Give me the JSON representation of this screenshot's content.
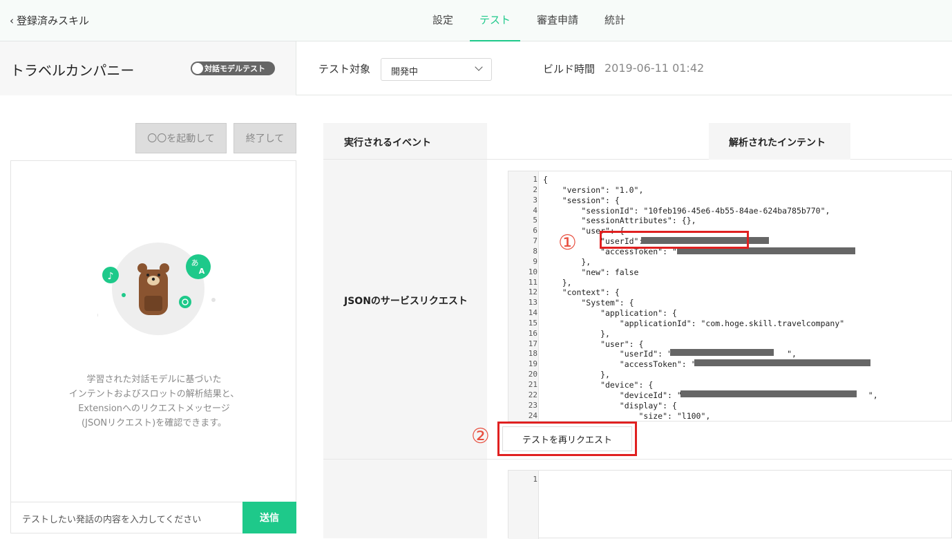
{
  "nav": {
    "back_label": "登録済みスキル",
    "tabs": [
      {
        "label": "設定"
      },
      {
        "label": "テスト"
      },
      {
        "label": "審査申請"
      },
      {
        "label": "統計"
      }
    ],
    "active_tab": "テスト"
  },
  "skill": {
    "name": "トラベルカンパニー",
    "toggle_label": "対話モデルテスト"
  },
  "test_target": {
    "label": "テスト対象",
    "selected": "開発中"
  },
  "build": {
    "label": "ビルド時間",
    "value": "2019-06-11 01:42"
  },
  "left": {
    "launch_button": "〇〇を起動して",
    "end_button": "終了して",
    "description_lines": [
      "学習された対話モデルに基づいた",
      "インテントおよびスロットの解析結果と、",
      "Extensionへのリクエストメッセージ",
      "(JSONリクエスト)を確認できます。"
    ],
    "input_placeholder": "テストしたい発話の内容を入力してください",
    "send_label": "送信"
  },
  "right": {
    "col_event": "実行されるイベント",
    "col_intent": "解析されたインテント",
    "json_label": "JSONのサービスリクエスト",
    "rerequest_label": "テストを再リクエスト",
    "marker1": "①",
    "marker2": "②"
  },
  "code_lines": [
    "{",
    "    \"version\": \"1.0\",",
    "    \"session\": {",
    "        \"sessionId\": \"10feb196-45e6-4b55-84ae-624ba785b770\",",
    "        \"sessionAttributes\": {},",
    "        \"user\": {",
    "            \"userId\":",
    "            \"accessToken\": \"",
    "        },",
    "        \"new\": false",
    "    },",
    "    \"context\": {",
    "        \"System\": {",
    "            \"application\": {",
    "                \"applicationId\": \"com.hoge.skill.travelcompany\"",
    "            },",
    "            \"user\": {",
    "                \"userId\": \"                        \",",
    "                \"accessToken\": \"",
    "            },",
    "            \"device\": {",
    "                \"deviceId\": \"                                       \",",
    "                \"display\": {",
    "                    \"size\": \"l100\","
  ],
  "code2_line": "1"
}
